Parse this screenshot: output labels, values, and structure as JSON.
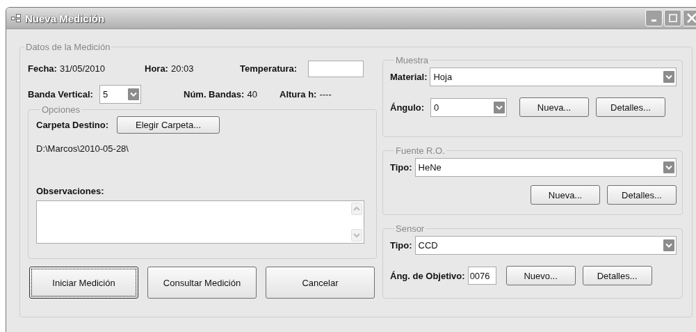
{
  "window": {
    "title": "Nueva Medición"
  },
  "datos": {
    "legend": "Datos de la Medición",
    "row1": [
      {
        "kind": "text",
        "label": "Fecha:",
        "value": "31/05/2010"
      },
      {
        "kind": "text",
        "label": "Hora:",
        "value": "20:03"
      },
      {
        "kind": "input",
        "label": "Temperatura:"
      }
    ],
    "row2": [
      {
        "kind": "combo",
        "label": "Banda Vertical:",
        "value": "5"
      },
      {
        "kind": "text",
        "label": "Núm. Bandas:",
        "value": "40"
      },
      {
        "kind": "text",
        "label": "Altura h:",
        "value": "----"
      }
    ],
    "opciones": {
      "legend": "Opciones",
      "carpeta_label": "Carpeta Destino:",
      "carpeta_button": "Elegir Carpeta...",
      "path": "D:\\Marcos\\2010-05-28\\",
      "observaciones_label": "Observaciones:"
    },
    "buttons": [
      {
        "label": "Iniciar Medición",
        "focused": true
      },
      {
        "label": "Consultar Medición",
        "focused": false
      },
      {
        "label": "Cancelar",
        "focused": false
      }
    ]
  },
  "muestra": {
    "legend": "Muestra",
    "material": {
      "label": "Material:",
      "value": "Hoja"
    },
    "angulo": {
      "label": "Ángulo:",
      "value": "0"
    },
    "buttons": [
      "Nueva...",
      "Detalles..."
    ]
  },
  "fuente": {
    "legend": "Fuente R.O.",
    "tipo": {
      "label": "Tipo:",
      "value": "HeNe"
    },
    "buttons": [
      "Nueva...",
      "Detalles..."
    ]
  },
  "sensor": {
    "legend": "Sensor",
    "tipo": {
      "label": "Tipo:",
      "value": "CCD"
    },
    "objetivo": {
      "label": "Áng. de Objetivo:",
      "value": "0076"
    },
    "buttons": [
      "Nuevo...",
      "Detalles..."
    ]
  }
}
